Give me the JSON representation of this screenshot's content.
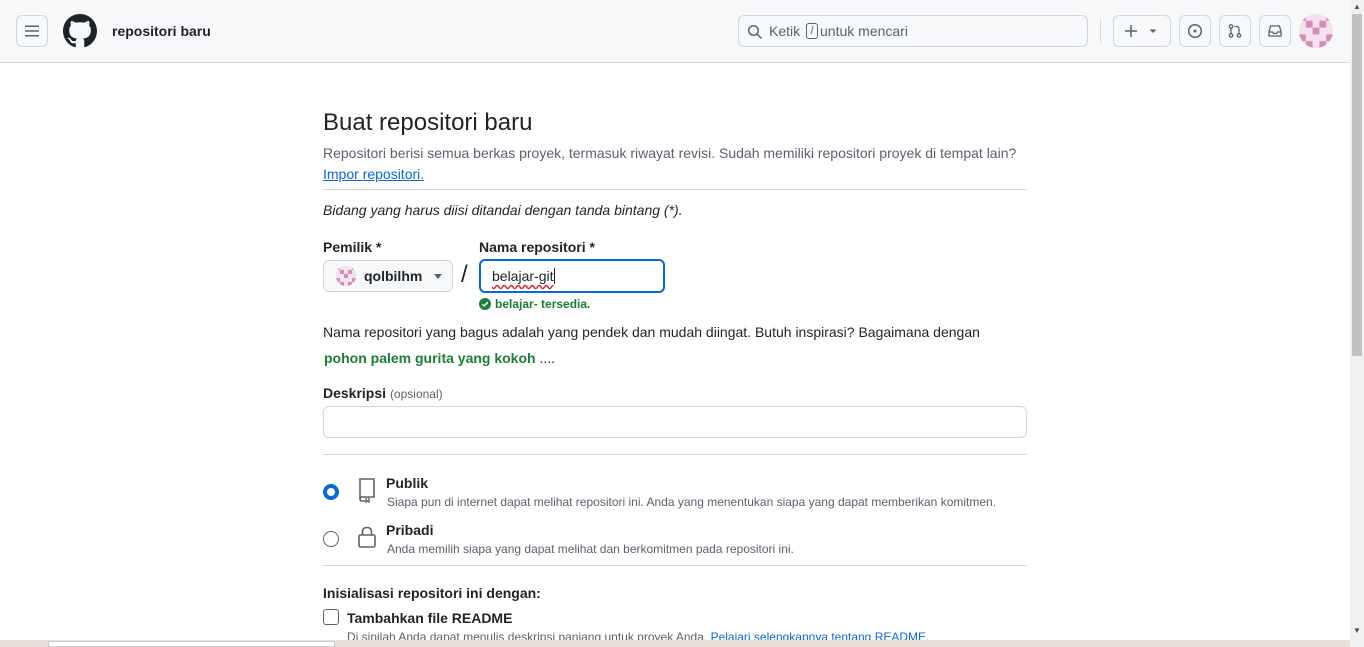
{
  "header": {
    "page_context": "repositori baru",
    "search": {
      "before": "Ketik",
      "key": "/",
      "after": "untuk mencari"
    }
  },
  "form": {
    "title": "Buat repositori baru",
    "intro": "Repositori berisi semua berkas proyek, termasuk riwayat revisi. Sudah memiliki repositori proyek di tempat lain?",
    "import_link": "Impor repositori.",
    "required_note": "Bidang yang harus diisi ditandai dengan tanda bintang (*).",
    "owner_label": "Pemilik *",
    "owner_value": "qolbilhm",
    "separator": "/",
    "name_label": "Nama repositori *",
    "name_value": "belajar-git",
    "availability": "belajar- tersedia.",
    "tip": "Nama repositori yang bagus adalah yang pendek dan mudah diingat. Butuh inspirasi? Bagaimana dengan",
    "suggestion": "pohon palem gurita yang kokoh",
    "suggestion_trail": "....",
    "description_label": "Deskripsi",
    "description_optional": "(opsional)",
    "description_value": ""
  },
  "visibility": {
    "selected": "public",
    "public_title": "Publik",
    "public_desc": "Siapa pun di internet dapat melihat repositori ini. Anda yang menentukan siapa yang dapat memberikan komitmen.",
    "private_title": "Pribadi",
    "private_desc": "Anda memilih siapa yang dapat melihat dan berkomitmen pada repositori ini."
  },
  "init": {
    "label": "Inisialisasi repositori ini dengan:",
    "readme_label": "Tambahkan file README",
    "readme_checked": false,
    "readme_desc": "Di sinilah Anda dapat menulis deskripsi panjang untuk proyek Anda.",
    "readme_link": "Pelajari selengkapnya tentang README."
  },
  "colors": {
    "accent": "#0969da",
    "success": "#1a7f37",
    "border": "#d0d7de"
  }
}
